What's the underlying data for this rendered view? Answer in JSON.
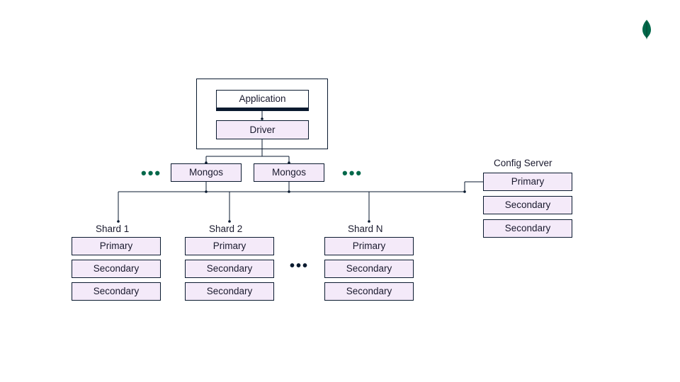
{
  "logo": {
    "name": "mongodb-leaf-icon"
  },
  "app": {
    "application_label": "Application",
    "driver_label": "Driver"
  },
  "mongos": {
    "left_label": "Mongos",
    "right_label": "Mongos"
  },
  "ellipsis": {
    "green": "•••",
    "black": "•••"
  },
  "shards": [
    {
      "label": "Shard 1",
      "nodes": [
        "Primary",
        "Secondary",
        "Secondary"
      ]
    },
    {
      "label": "Shard 2",
      "nodes": [
        "Primary",
        "Secondary",
        "Secondary"
      ]
    },
    {
      "label": "Shard N",
      "nodes": [
        "Primary",
        "Secondary",
        "Secondary"
      ]
    }
  ],
  "config_server": {
    "label": "Config Server",
    "nodes": [
      "Primary",
      "Secondary",
      "Secondary"
    ]
  }
}
